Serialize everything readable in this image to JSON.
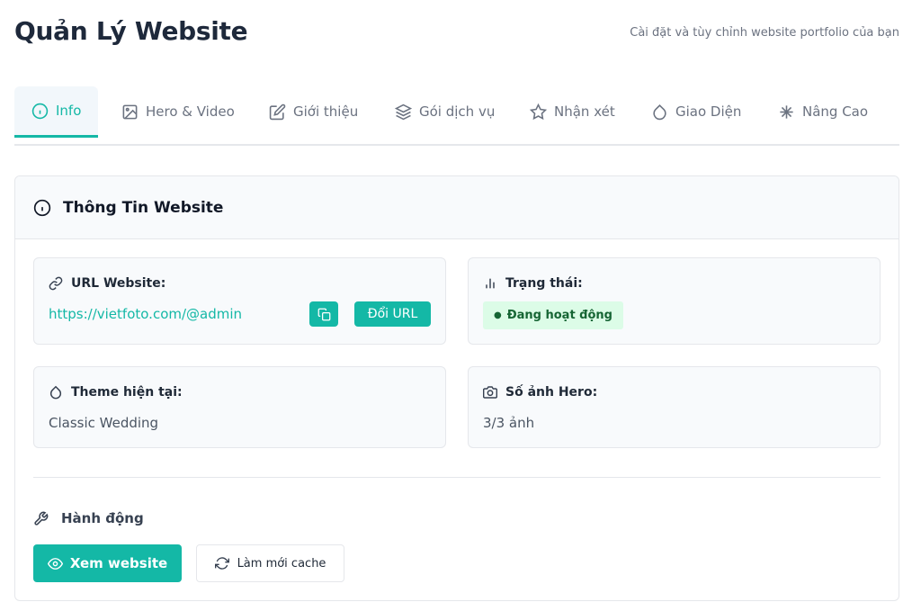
{
  "header": {
    "title": "Quản Lý Website",
    "subtitle": "Cài đặt và tùy chỉnh website portfolio của bạn"
  },
  "tabs": [
    {
      "label": "Info",
      "icon": "info-icon",
      "active": true
    },
    {
      "label": "Hero & Video",
      "icon": "image-icon",
      "active": false
    },
    {
      "label": "Giới thiệu",
      "icon": "edit-icon",
      "active": false
    },
    {
      "label": "Gói dịch vụ",
      "icon": "layers-icon",
      "active": false
    },
    {
      "label": "Nhận xét",
      "icon": "star-icon",
      "active": false
    },
    {
      "label": "Giao Diện",
      "icon": "droplet-icon",
      "active": false
    },
    {
      "label": "Nâng Cao",
      "icon": "sparkle-icon",
      "active": false
    }
  ],
  "card": {
    "title": "Thông Tin Website",
    "url": {
      "label": "URL Website:",
      "value": "https://vietfoto.com/@admin",
      "change_label": "Đổi URL"
    },
    "status": {
      "label": "Trạng thái:",
      "value": "Đang hoạt động",
      "dot": "●"
    },
    "theme": {
      "label": "Theme hiện tại:",
      "value": "Classic Wedding"
    },
    "hero_count": {
      "label": "Số ảnh Hero:",
      "value": "3/3 ảnh"
    },
    "actions": {
      "label": "Hành động",
      "view_label": "Xem website",
      "refresh_label": "Làm mới cache"
    }
  },
  "colors": {
    "accent": "#14b8a6",
    "status_bg": "#dcfce7",
    "status_text": "#166534"
  }
}
